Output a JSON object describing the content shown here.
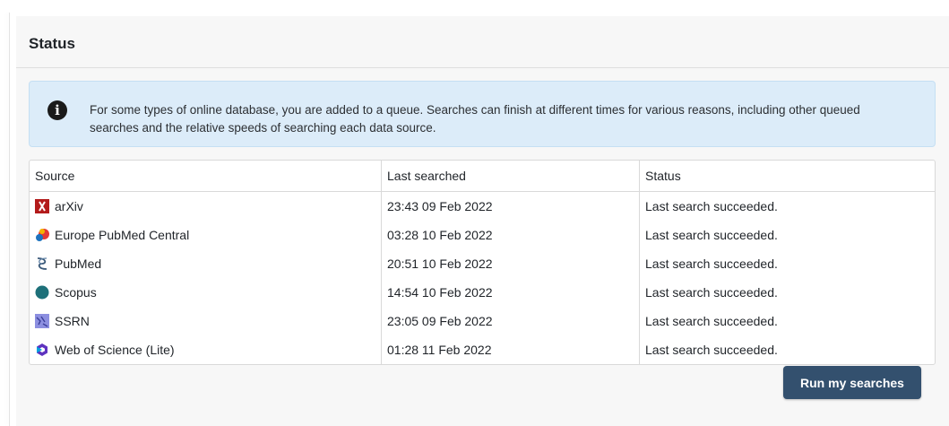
{
  "panel": {
    "title": "Status"
  },
  "info": {
    "icon": "info-icon",
    "text": "For some types of online database, you are added to a queue. Searches can finish at different times for various reasons, including other queued searches and the relative speeds of searching each data source."
  },
  "table": {
    "headers": [
      "Source",
      "Last searched",
      "Status"
    ],
    "rows": [
      {
        "icon": "arxiv-logo-icon",
        "source": "arXiv",
        "last_searched": "23:43 09 Feb 2022",
        "status": "Last search succeeded."
      },
      {
        "icon": "europe-pmc-logo-icon",
        "source": "Europe PubMed Central",
        "last_searched": "03:28 10 Feb 2022",
        "status": "Last search succeeded."
      },
      {
        "icon": "pubmed-logo-icon",
        "source": "PubMed",
        "last_searched": "20:51 10 Feb 2022",
        "status": "Last search succeeded."
      },
      {
        "icon": "scopus-logo-icon",
        "source": "Scopus",
        "last_searched": "14:54 10 Feb 2022",
        "status": "Last search succeeded."
      },
      {
        "icon": "ssrn-logo-icon",
        "source": "SSRN",
        "last_searched": "23:05 09 Feb 2022",
        "status": "Last search succeeded."
      },
      {
        "icon": "web-of-science-logo-icon",
        "source": "Web of Science (Lite)",
        "last_searched": "01:28 11 Feb 2022",
        "status": "Last search succeeded."
      }
    ]
  },
  "actions": {
    "run_label": "Run my searches"
  },
  "colors": {
    "button": "#33506e",
    "info_background": "#dcecf9",
    "panel_background": "#f7f7f7"
  }
}
